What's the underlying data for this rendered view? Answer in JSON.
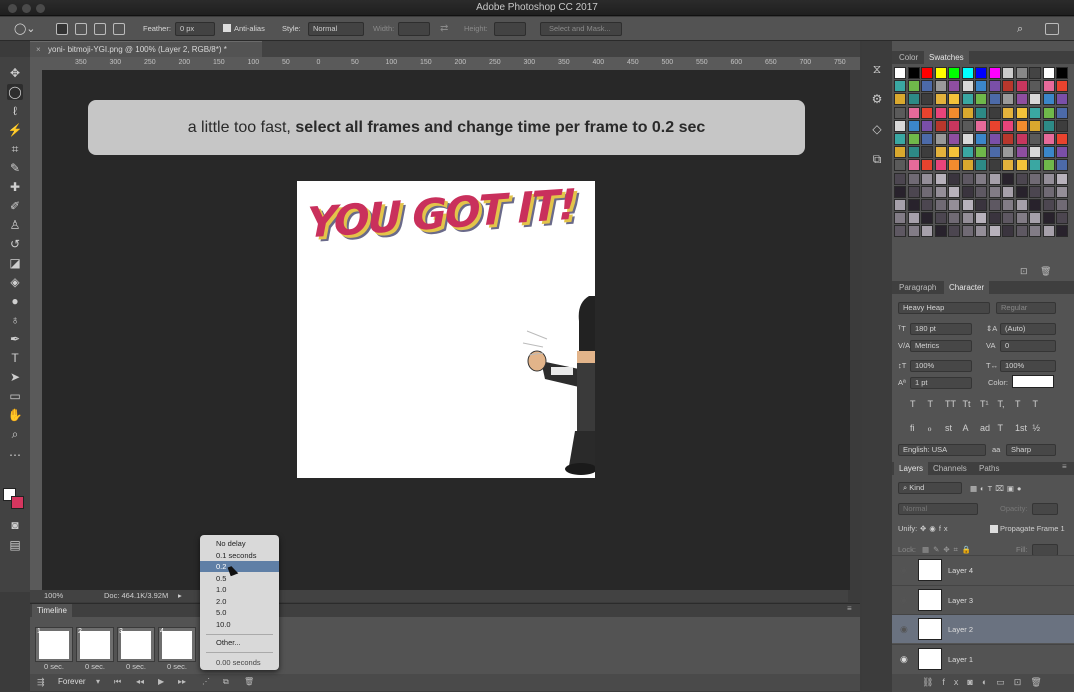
{
  "app": {
    "title": "Adobe Photoshop CC 2017"
  },
  "options": {
    "feather_label": "Feather:",
    "feather_value": "0 px",
    "anti_alias": "Anti-alias",
    "style_label": "Style:",
    "style_value": "Normal",
    "width_label": "Width:",
    "height_label": "Height:",
    "select_mask": "Select and Mask..."
  },
  "doc_tab": {
    "title": "yoni- bitmoji-YGI.png @ 100% (Layer 2, RGB/8*) *"
  },
  "ruler": {
    "ticks": [
      "350",
      "300",
      "250",
      "200",
      "150",
      "100",
      "50",
      "0",
      "50",
      "100",
      "150",
      "200",
      "250",
      "300",
      "350",
      "400",
      "450",
      "500",
      "550",
      "600",
      "650",
      "700",
      "750"
    ]
  },
  "instruction": {
    "plain": "a little too fast,",
    "bold": "select all frames and change time per frame to 0.2 sec"
  },
  "canvas_art": {
    "headline": "YOU GOT IT!"
  },
  "status": {
    "zoom": "100%",
    "doc": "Doc: 464.1K/3.92M"
  },
  "timeline": {
    "title": "Timeline",
    "frames": [
      {
        "num": "1",
        "delay": "0 sec."
      },
      {
        "num": "2",
        "delay": "0 sec."
      },
      {
        "num": "3",
        "delay": "0 sec."
      },
      {
        "num": "4",
        "delay": "0 sec."
      }
    ],
    "loop": "Forever"
  },
  "delay_menu": {
    "items": [
      "No delay",
      "0.1 seconds",
      "0.2",
      "0.5",
      "1.0",
      "2.0",
      "5.0",
      "10.0"
    ],
    "selected": "0.2",
    "other": "Other...",
    "current": "0.00 seconds"
  },
  "color_panel": {
    "tab_color": "Color",
    "tab_swatches": "Swatches"
  },
  "char_panel": {
    "tab_para": "Paragraph",
    "tab_char": "Character",
    "font": "Heavy Heap",
    "style": "Regular",
    "size": "180 pt",
    "leading": "(Auto)",
    "kerning": "Metrics",
    "tracking": "0",
    "vscale": "100%",
    "hscale": "100%",
    "baseline": "1 pt",
    "color_label": "Color:",
    "lang": "English: USA",
    "aa": "aa",
    "sharp": "Sharp",
    "styles_row": [
      "T",
      "T",
      "TT",
      "Tt",
      "T¹",
      "T,",
      "T",
      "T"
    ],
    "ot_row": [
      "fi",
      "ℴ",
      "st",
      "A",
      "ad",
      "T",
      "1st",
      "½"
    ]
  },
  "layers_panel": {
    "tabs": [
      "Layers",
      "Channels",
      "Paths"
    ],
    "kind": "Kind",
    "blend": "Normal",
    "opacity_label": "Opacity:",
    "unify_label": "Unify:",
    "propagate": "Propagate Frame 1",
    "lock_label": "Lock:",
    "fill_label": "Fill:",
    "layers": [
      "Layer 4",
      "Layer 3",
      "Layer 2",
      "Layer 1"
    ]
  }
}
